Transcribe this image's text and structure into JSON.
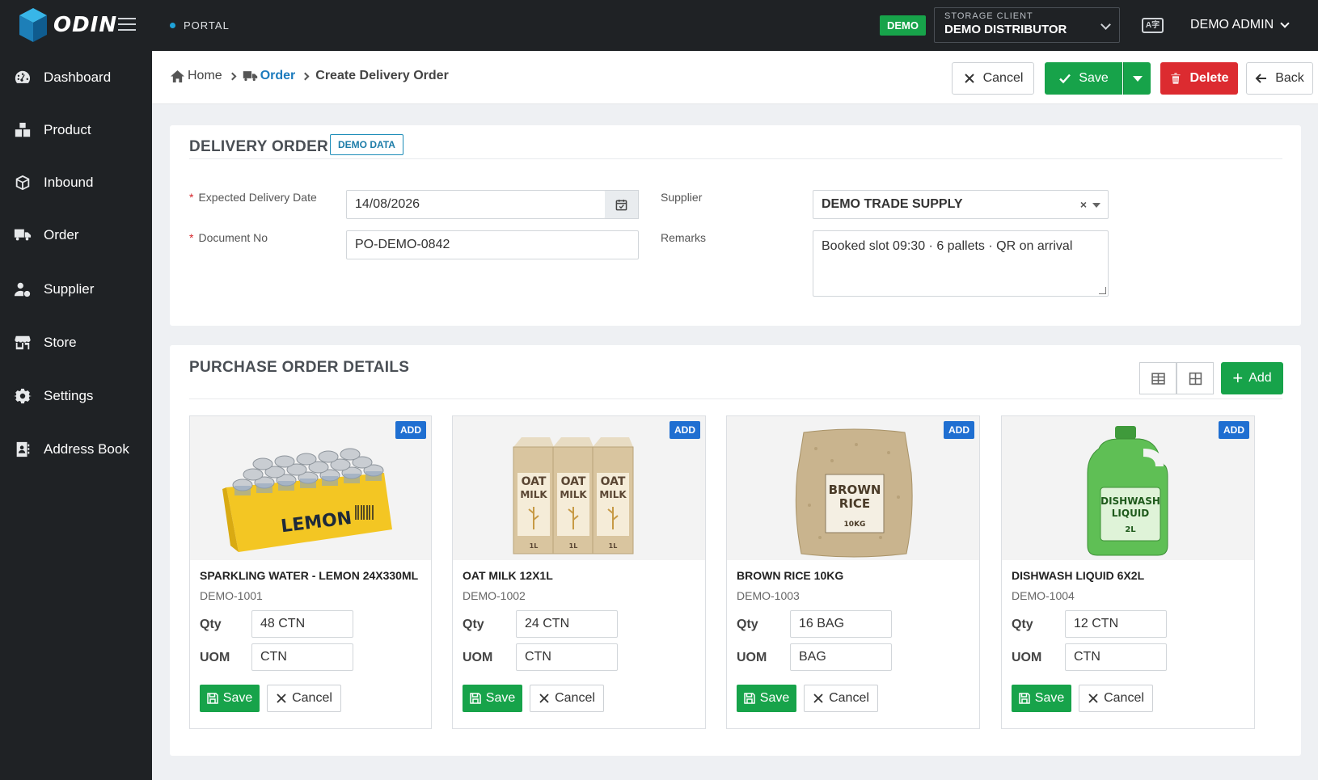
{
  "header": {
    "logo_text": "ODIN",
    "portal_label": "PORTAL",
    "demo_badge": "DEMO",
    "storage_client_label": "STORAGE CLIENT",
    "storage_client_value": "DEMO DISTRIBUTOR",
    "user_name": "DEMO ADMIN"
  },
  "sidebar": {
    "items": [
      {
        "label": "Dashboard",
        "icon": "dashboard-icon"
      },
      {
        "label": "Product",
        "icon": "boxes-icon"
      },
      {
        "label": "Inbound",
        "icon": "box-icon"
      },
      {
        "label": "Order",
        "icon": "truck-icon"
      },
      {
        "label": "Supplier",
        "icon": "user-icon"
      },
      {
        "label": "Store",
        "icon": "store-icon"
      },
      {
        "label": "Settings",
        "icon": "gear-icon"
      },
      {
        "label": "Address Book",
        "icon": "address-book-icon"
      }
    ]
  },
  "breadcrumb": {
    "home": "Home",
    "order": "Order",
    "current": "Create Delivery Order"
  },
  "toolbar": {
    "cancel_label": "Cancel",
    "save_label": "Save",
    "delete_label": "Delete",
    "back_label": "Back"
  },
  "delivery_order": {
    "title": "DELIVERY ORDER",
    "badge": "DEMO DATA",
    "expected_date_label": "Expected Delivery Date",
    "expected_date_value": "14/08/2026",
    "document_no_label": "Document No",
    "document_no_value": "PO-DEMO-0842",
    "supplier_label": "Supplier",
    "supplier_value": "DEMO TRADE SUPPLY",
    "remarks_label": "Remarks",
    "remarks_value": "Booked slot 09:30 · 6 pallets · QR on arrival"
  },
  "po_details": {
    "title": "PURCHASE ORDER DETAILS",
    "add_label": "Add",
    "qty_label": "Qty",
    "uom_label": "UOM",
    "add_badge": "ADD",
    "save_label": "Save",
    "cancel_label": "Cancel",
    "products": [
      {
        "name": "SPARKLING WATER - LEMON 24X330ML",
        "code": "DEMO-1001",
        "qty": "48 CTN",
        "uom": "CTN",
        "image_text": [
          "LEMON"
        ]
      },
      {
        "name": "OAT MILK 12X1L",
        "code": "DEMO-1002",
        "qty": "24 CTN",
        "uom": "CTN",
        "image_text": [
          "OAT",
          "MILK",
          "1L"
        ]
      },
      {
        "name": "BROWN RICE 10KG",
        "code": "DEMO-1003",
        "qty": "16 BAG",
        "uom": "BAG",
        "image_text": [
          "BROWN",
          "RICE",
          "10KG"
        ]
      },
      {
        "name": "DISHWASH LIQUID 6X2L",
        "code": "DEMO-1004",
        "qty": "12 CTN",
        "uom": "CTN",
        "image_text": [
          "DISHWASH",
          "LIQUID",
          "2L"
        ]
      }
    ]
  },
  "colors": {
    "topbar": "#1f2225",
    "green": "#17a34a",
    "red": "#dc2b30",
    "blue_link": "#1c7bbd",
    "add_badge": "#1f6fd1"
  }
}
